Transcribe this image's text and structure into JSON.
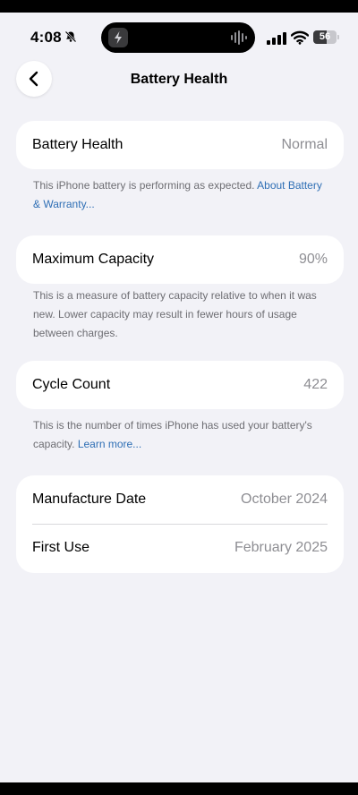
{
  "status_bar": {
    "time": "4:08",
    "battery_level": "56",
    "battery_fraction": 0.56,
    "icons": [
      "bell-slash-icon",
      "bolt-icon",
      "waveform-icon",
      "cellular-signal-icon",
      "wifi-icon",
      "battery-icon"
    ]
  },
  "nav": {
    "title": "Battery Health",
    "back_icon": "chevron-left-icon"
  },
  "sections": {
    "health": {
      "label": "Battery Health",
      "value": "Normal",
      "footer_text": "This iPhone battery is performing as expected. ",
      "footer_link": "About Battery & Warranty..."
    },
    "capacity": {
      "label": "Maximum Capacity",
      "value": "90%",
      "footer_text": "This is a measure of battery capacity relative to when it was new. Lower capacity may result in fewer hours of usage between charges."
    },
    "cycles": {
      "label": "Cycle Count",
      "value": "422",
      "footer_text": "This is the number of times iPhone has used your battery's capacity. ",
      "footer_link": "Learn more..."
    },
    "dates": {
      "manufacture_label": "Manufacture Date",
      "manufacture_value": "October 2024",
      "first_use_label": "First Use",
      "first_use_value": "February 2025"
    }
  },
  "colors": {
    "background": "#f2f2f7",
    "card": "#ffffff",
    "link": "#2f6fb5",
    "secondary_text": "#8e8e93"
  }
}
